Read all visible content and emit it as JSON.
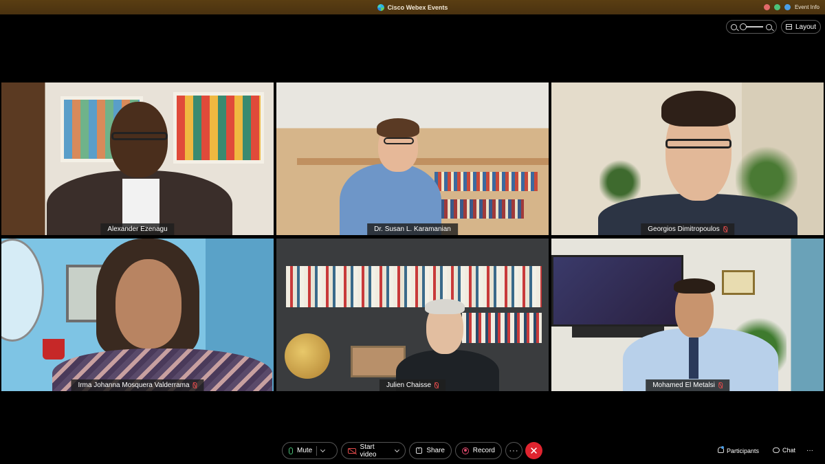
{
  "window": {
    "title": "Cisco Webex Events",
    "event_info": "Event Info"
  },
  "top_controls": {
    "layout_label": "Layout"
  },
  "participants": [
    {
      "name": "Alexander Ezenagu",
      "muted": false
    },
    {
      "name": "Dr. Susan L. Karamanian",
      "muted": false
    },
    {
      "name": "Georgios Dimitropoulos",
      "muted": true
    },
    {
      "name": "Irma Johanna Mosquera Valderrama",
      "muted": true
    },
    {
      "name": "Julien Chaisse",
      "muted": true
    },
    {
      "name": "Mohamed El Metalsi",
      "muted": true
    }
  ],
  "toolbar": {
    "mute_label": "Mute",
    "start_video_label": "Start video",
    "share_label": "Share",
    "record_label": "Record",
    "more_label": "···",
    "participants_label": "Participants",
    "chat_label": "Chat",
    "overflow_label": "···"
  },
  "colors": {
    "leave": "#e0242f",
    "mic_active": "#4cc47a",
    "muted": "#e24b4b",
    "accent": "#4a9ee8"
  }
}
